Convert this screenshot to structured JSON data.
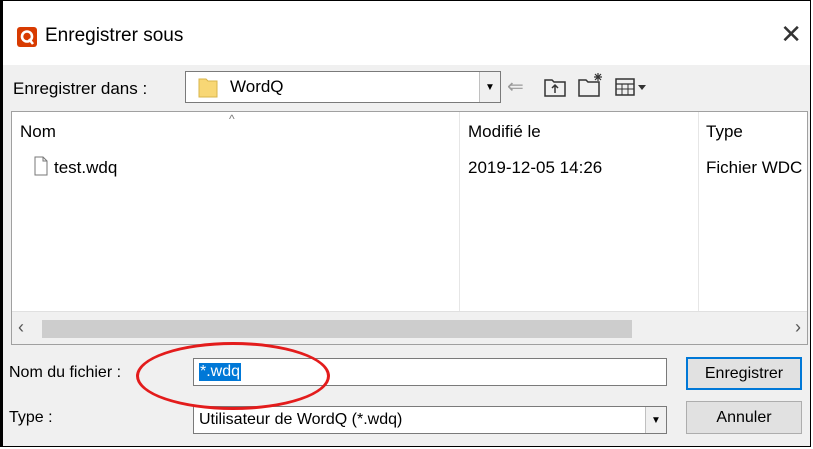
{
  "window": {
    "title": "Enregistrer sous",
    "close_glyph": "✕"
  },
  "location": {
    "label": "Enregistrer dans :",
    "value": "WordQ"
  },
  "toolbar_icons": [
    "back-arrow-icon",
    "up-folder-icon",
    "new-folder-icon",
    "view-menu-icon"
  ],
  "columns": {
    "name": "Nom",
    "modified": "Modifié le",
    "type": "Type"
  },
  "files": [
    {
      "name": "test.wdq",
      "modified": "2019-12-05 14:26",
      "type": "Fichier WDC"
    }
  ],
  "filename": {
    "label": "Nom du fichier :",
    "value": "*.wdq"
  },
  "filetype": {
    "label": "Type :",
    "value": "Utilisateur de WordQ (*.wdq)"
  },
  "buttons": {
    "save": "Enregistrer",
    "cancel": "Annuler"
  },
  "colors": {
    "accent": "#0078d7",
    "annotation": "#e31c1c",
    "app_icon": "#d83b01"
  }
}
